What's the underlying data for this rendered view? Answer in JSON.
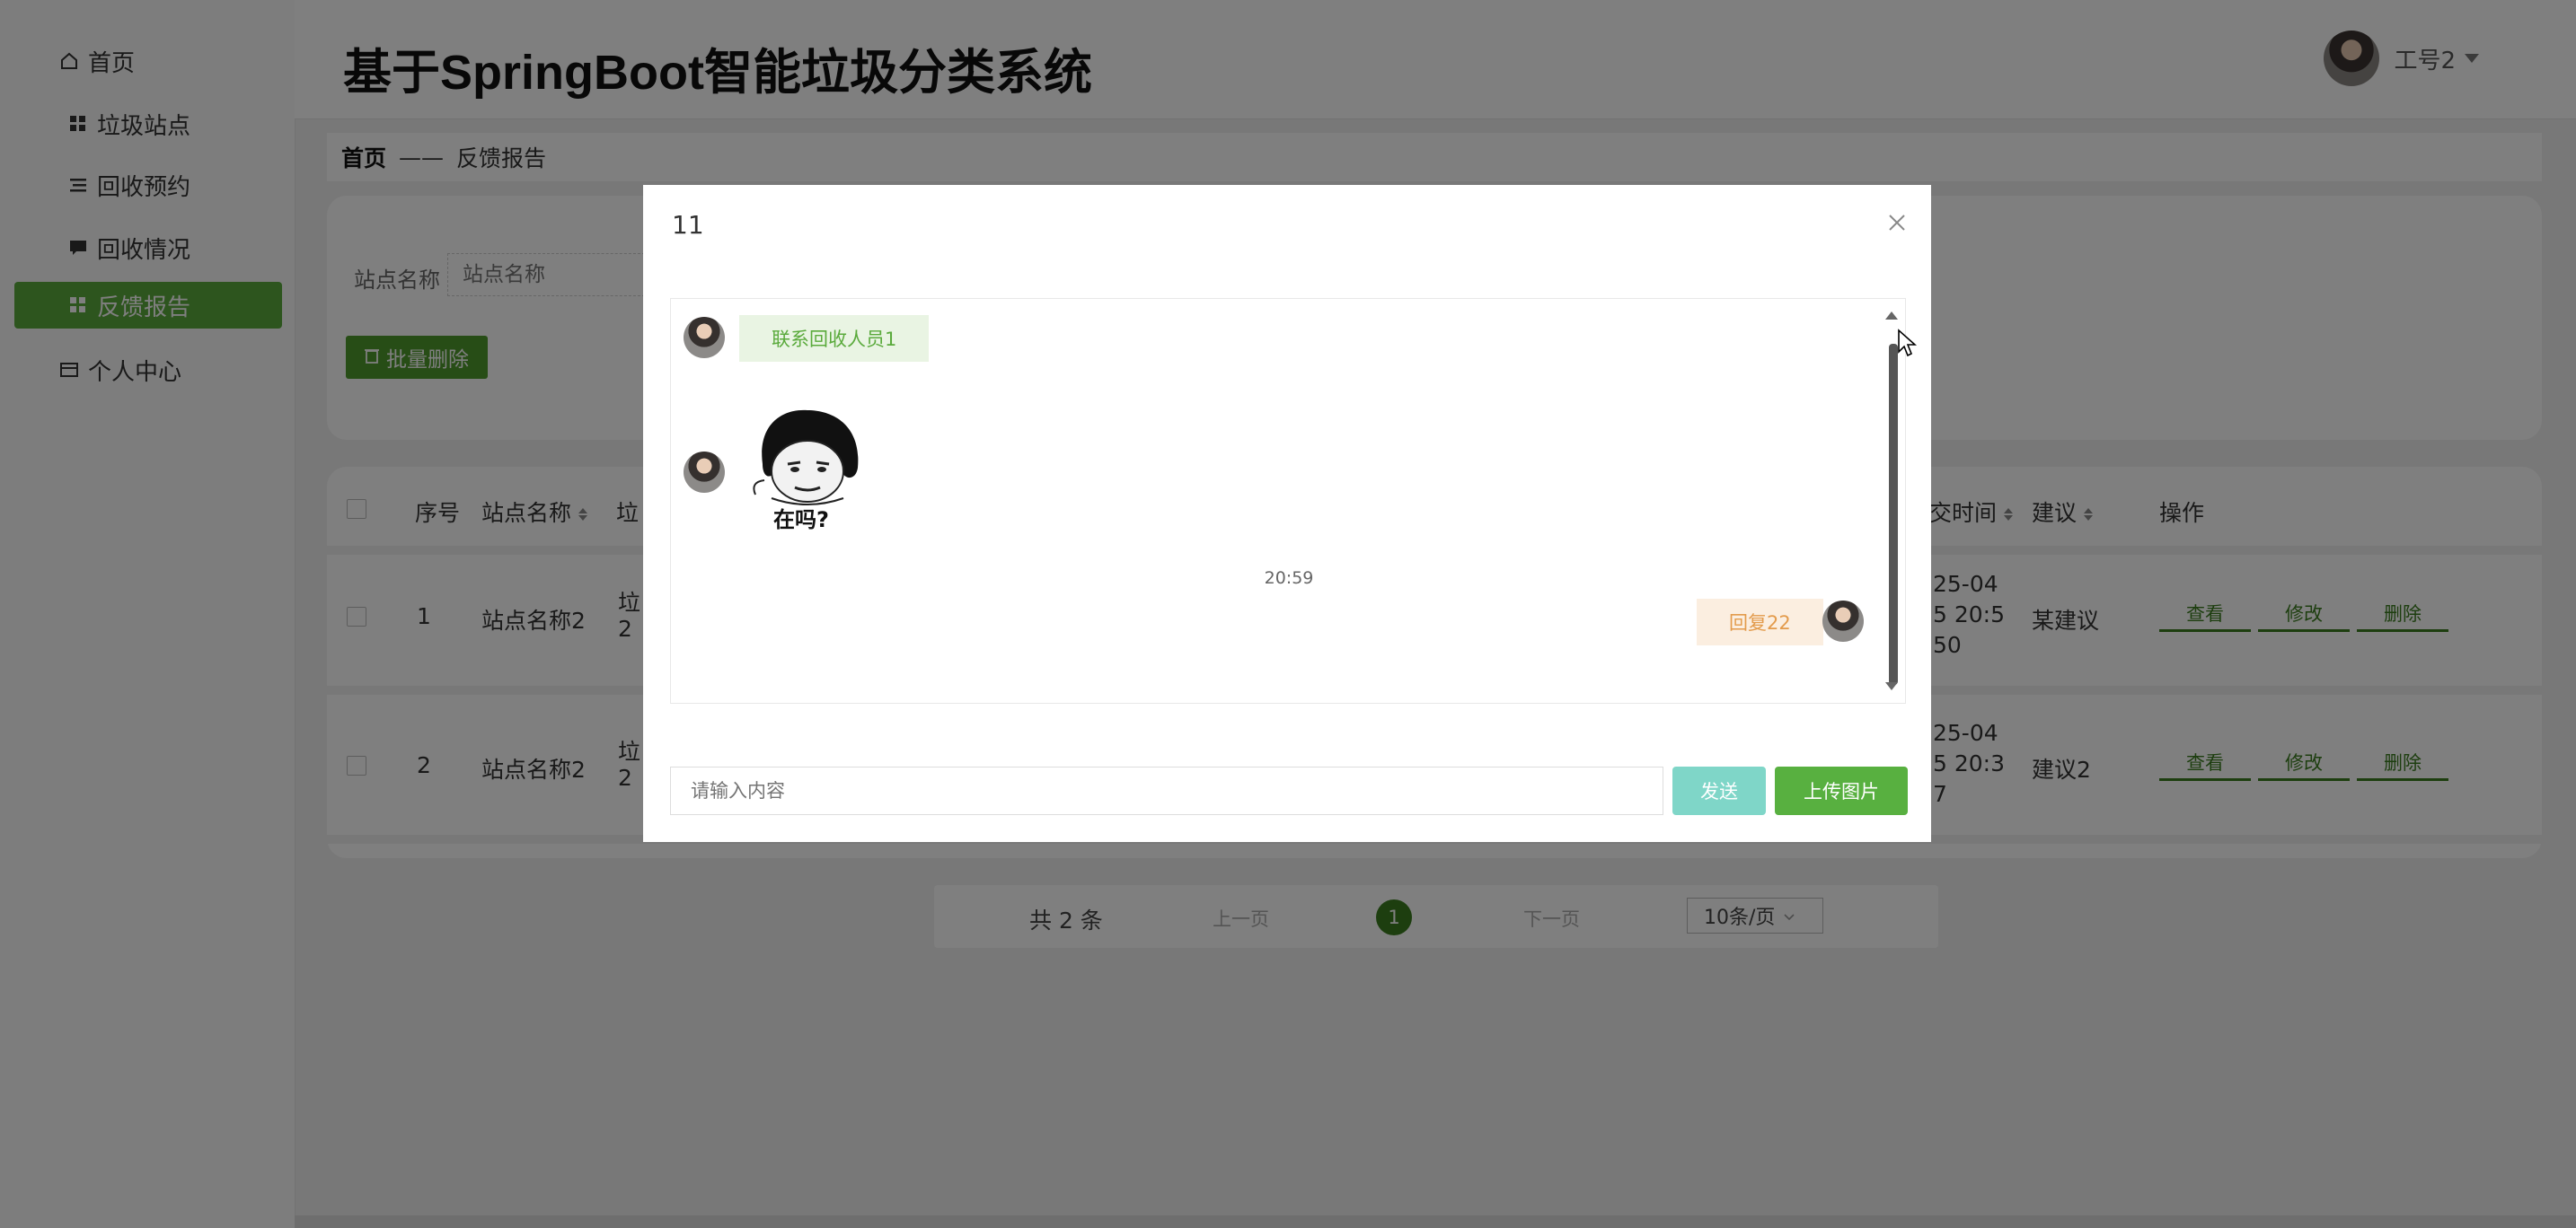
{
  "app": {
    "title": "基于SpringBoot智能垃圾分类系统",
    "user_name": "工号2"
  },
  "sidebar": {
    "items": [
      {
        "label": "首页",
        "icon": "home-icon"
      },
      {
        "label": "垃圾站点",
        "icon": "grid-icon"
      },
      {
        "label": "回收预约",
        "icon": "list-icon"
      },
      {
        "label": "回收情况",
        "icon": "chat-icon"
      },
      {
        "label": "反馈报告",
        "icon": "grid-icon",
        "active": true
      },
      {
        "label": "个人中心",
        "icon": "card-icon"
      }
    ]
  },
  "breadcrumb": {
    "home": "首页",
    "sep": "——",
    "current": "反馈报告"
  },
  "search": {
    "label": "站点名称",
    "placeholder": "站点名称"
  },
  "toolbar": {
    "batch_delete": "批量删除"
  },
  "table": {
    "headers": [
      "序号",
      "站点名称",
      "垃",
      "交时间",
      "建议",
      "操作"
    ],
    "rows": [
      {
        "index": "1",
        "station": "站点名称2",
        "col3": [
          "垃",
          "2"
        ],
        "time": [
          "25-04",
          "5 20:5",
          "50"
        ],
        "advice": "某建议"
      },
      {
        "index": "2",
        "station": "站点名称2",
        "col3": [
          "垃",
          "2"
        ],
        "time": [
          "25-04",
          "5 20:3",
          "7"
        ],
        "advice": "建议2"
      }
    ],
    "actions": {
      "view": "查看",
      "edit": "修改",
      "delete": "删除"
    }
  },
  "pager": {
    "total": "共 2 条",
    "prev": "上一页",
    "page": "1",
    "next": "下一页",
    "size": "10条/页"
  },
  "modal": {
    "title": "11",
    "messages": {
      "left_text": "联系回收人员1",
      "sticker_text": "在吗?",
      "timestamp": "20:59",
      "right_text": "回复22"
    },
    "input_placeholder": "请输入内容",
    "send": "发送",
    "upload": "上传图片"
  },
  "colors": {
    "accent": "#4e9a2c",
    "active_menu": "#5aaa3c",
    "send": "#7fd6c8"
  }
}
